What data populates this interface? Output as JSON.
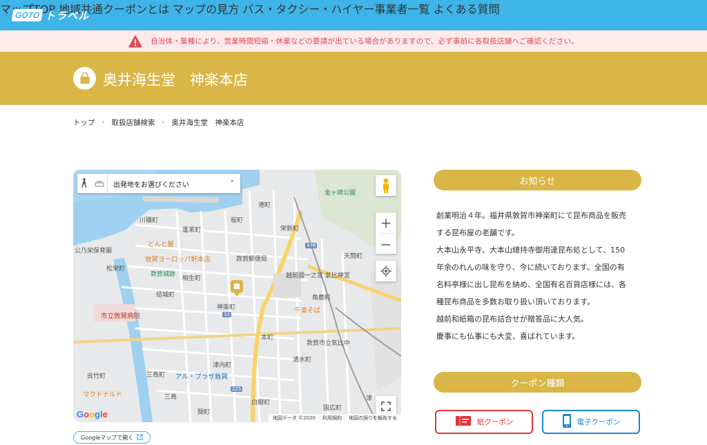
{
  "header": {
    "logo_goto": "GOTO",
    "logo_travel": "トラベル",
    "nav": [
      {
        "label": "マップTOP"
      },
      {
        "label": "地域共通クーポンとは"
      },
      {
        "label": "マップの見方"
      },
      {
        "label": "バス・タクシー・ハイヤー事業者一覧"
      },
      {
        "label": "よくある質問"
      }
    ]
  },
  "alert": {
    "icon": "warning-icon",
    "text": "自治体・業種により、営業時間短縮・休業などの要請が出ている場合がありますので、必ず事前に各取扱店舗へご確認ください。"
  },
  "store": {
    "icon": "shopping-bag-icon",
    "title": "奥井海生堂　神楽本店"
  },
  "breadcrumb": {
    "items": [
      "トップ",
      "取扱店舗検索",
      "奥井海生堂　神楽本店"
    ],
    "separator": "›"
  },
  "map": {
    "directions_placeholder": "出発地をお選びください",
    "labels": {
      "kanegasaki": "金ヶ崎公園",
      "minato": "港町",
      "kawaiso": "川磯町",
      "horai": "蓬莱町",
      "sakura": "桜町",
      "eishin": "栄新町",
      "kouritsu_hoikuen": "公乃栄保育園",
      "dontoya": "どんと屋",
      "europe": "敦賀ヨーロッパ軒本店",
      "yubinkyoku": "敦賀郵便局",
      "matsuei": "松栄町",
      "castle": "敦賀城跡",
      "aioi": "相生町",
      "kehi": "越前國一之宮 氣比神宮",
      "yuki": "結城町",
      "kagura": "神楽町",
      "senju": "千束そば",
      "hospital": "市立敦賀病院",
      "honmachi": "本町",
      "kakudeta": "角鹿町",
      "tennou": "天筒町",
      "kehi_junior": "敦賀市立気比中",
      "shimizu": "清水町",
      "tsunai": "津内町",
      "fukuin": "呉竹町",
      "shimano": "三島町",
      "alplaza": "アル・プラザ敦賀",
      "mcdonalds": "マクドナルド",
      "shima": "三島",
      "shiroganecho": "白銀町",
      "kaihatsu": "開町",
      "hirohiro": "国広町",
      "tsunaga": "津",
      "route476": "476",
      "route33": "33",
      "route225": "225"
    },
    "google_logo": "Google",
    "attribution": [
      "地図データ ©2020",
      "利用規約",
      "地図の誤りを報告する"
    ],
    "open_link": "Googleマップで開く"
  },
  "notice": {
    "heading": "お知らせ",
    "lines": [
      "創業明治４年。福井県敦賀市神楽町にて昆布商品を販売",
      "する昆布屋の老舗です。",
      "大本山永平寺、大本山總持寺御用達昆布処として、150",
      "年余のれんの味を守り、今に続いております。全国の有",
      "名料亭様に出し昆布を納め、全国有名百貨店様には、各",
      "種昆布商品を多数お取り扱い頂いております。",
      "越前和紙箱の昆布詰合せが贈答品に大人気。",
      "慶事にも仏事にも大変、喜ばれています。"
    ]
  },
  "coupons": {
    "heading": "クーポン種類",
    "paper": "紙クーポン",
    "digital": "電子クーポン"
  },
  "colors": {
    "header": "#3eb4e8",
    "band": "#d9b646",
    "alert_bg": "#fdeaea",
    "alert_text": "#e04a5a",
    "paper": "#e5333a",
    "digital": "#1e86c9"
  }
}
